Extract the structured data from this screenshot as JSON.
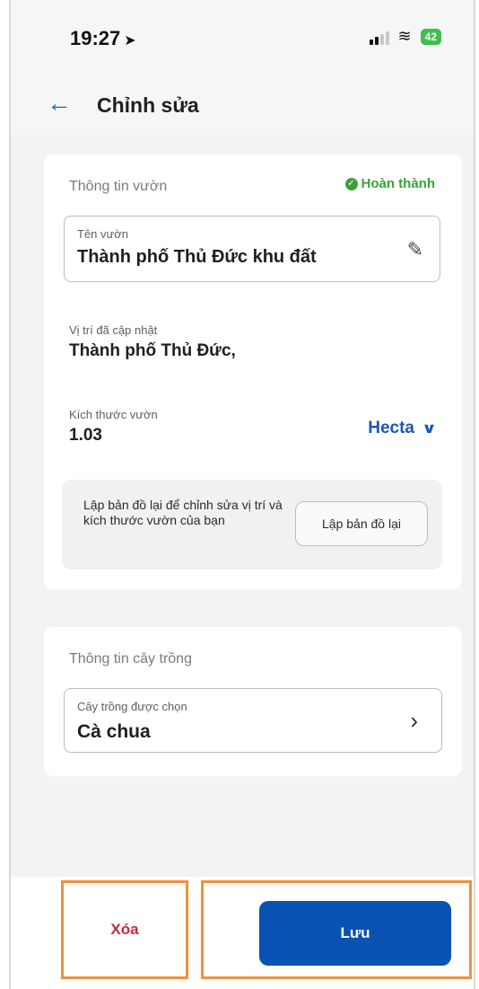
{
  "status_bar": {
    "time": "19:27",
    "time_icon": "location-arrow-icon",
    "battery": "42"
  },
  "header": {
    "back_icon": "back-arrow-icon",
    "title": "Chỉnh sửa"
  },
  "garden_info": {
    "section_title": "Thông tin vườn",
    "status": "Hoàn thành",
    "status_color": "#3aa23a",
    "name_field": {
      "label": "Tên vườn",
      "value": "Thành phố Thủ Đức khu đất"
    },
    "location": {
      "label": "Vị trí đã cập nhật",
      "value": "Thành phố Thủ Đức,"
    },
    "size": {
      "label": "Kích thước vườn",
      "value": "1.03",
      "unit": "Hecta"
    },
    "remap": {
      "text": "Lập bản đồ lại để chỉnh sửa vị trí và kích thước vườn của bạn",
      "button": "Lập bản đồ lại"
    }
  },
  "crop_info": {
    "section_title": "Thông tin cây trồng",
    "crop_field": {
      "label": "Cây trồng được chọn",
      "value": "Cà chua"
    }
  },
  "actions": {
    "delete_label": "Xóa",
    "delete_color": "#c8283c",
    "save_label": "Lưu",
    "save_color": "#0a52b2"
  }
}
